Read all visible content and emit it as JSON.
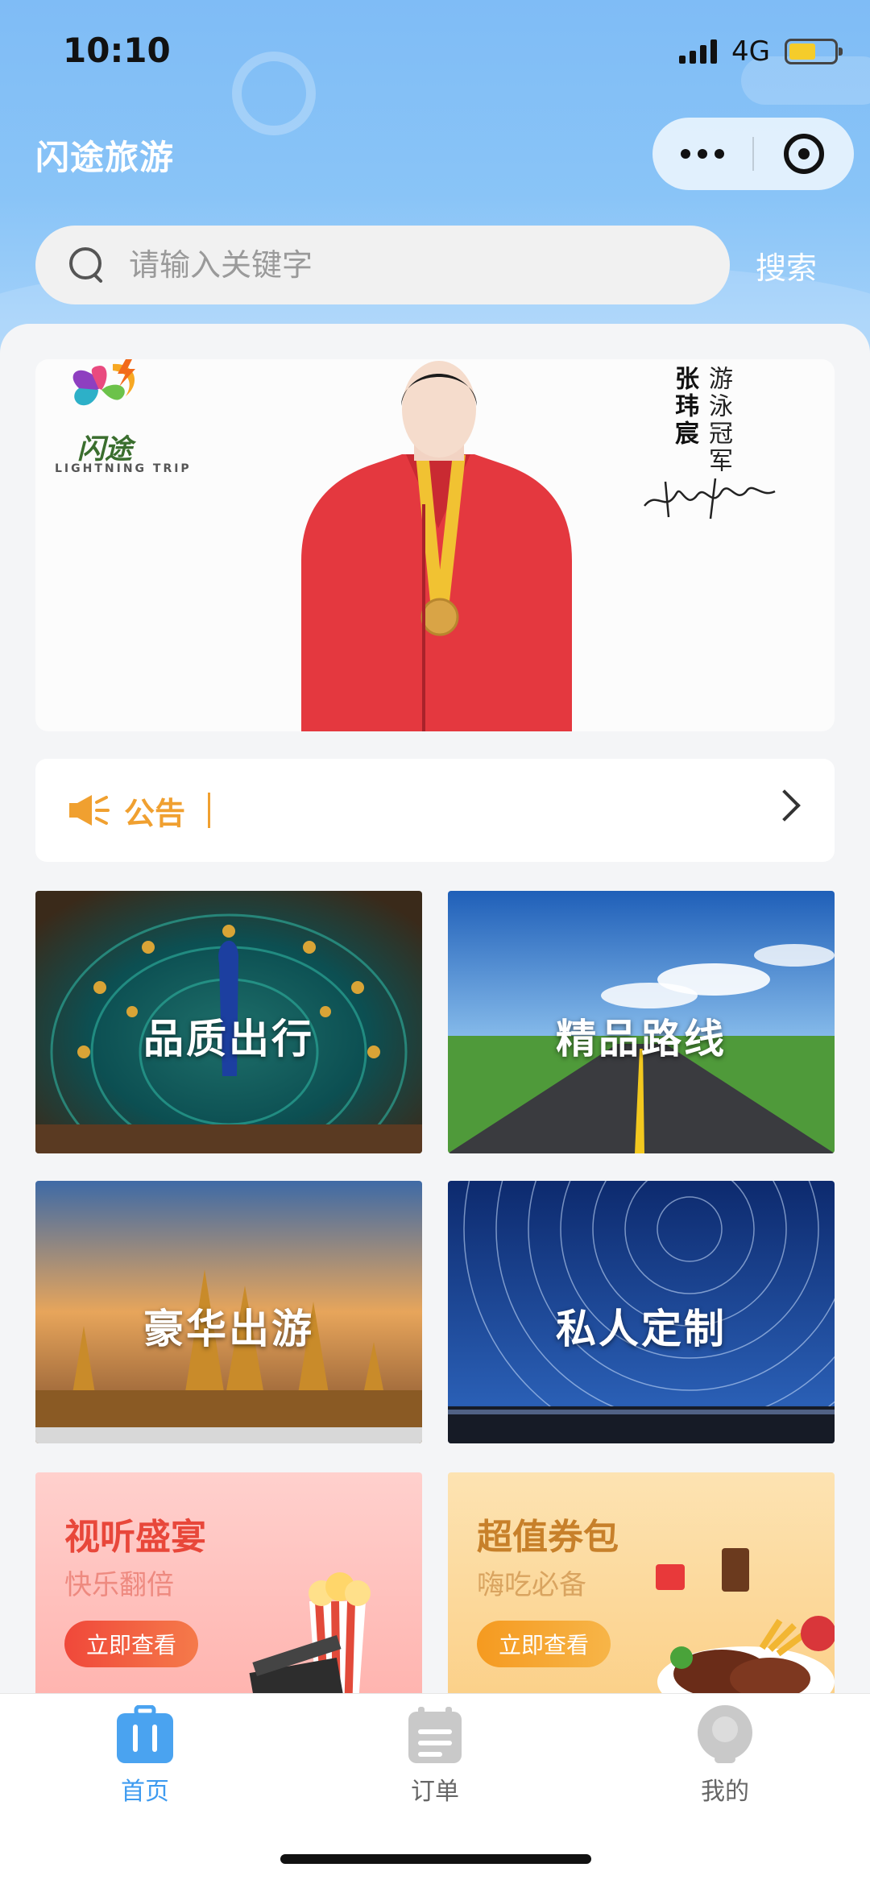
{
  "status_bar": {
    "time": "10:10",
    "network": "4G"
  },
  "header": {
    "app_title": "闪途旅游"
  },
  "search": {
    "placeholder": "请输入关键字",
    "value": "",
    "button_label": "搜索"
  },
  "banner": {
    "logo_text": "闪途",
    "logo_subtext": "LIGHTNING TRIP",
    "person_name": "张玮宸",
    "person_title": "游泳冠军"
  },
  "notice": {
    "label": "公告"
  },
  "tiles": [
    {
      "label": "品质出行"
    },
    {
      "label": "精品路线"
    },
    {
      "label": "豪华出游"
    },
    {
      "label": "私人定制"
    }
  ],
  "promos": [
    {
      "title": "视听盛宴",
      "subtitle": "快乐翻倍",
      "button": "立即查看"
    },
    {
      "title": "超值券包",
      "subtitle": "嗨吃必备",
      "button": "立即查看"
    }
  ],
  "tabbar": [
    {
      "label": "首页",
      "active": true
    },
    {
      "label": "订单",
      "active": false
    },
    {
      "label": "我的",
      "active": false
    }
  ],
  "colors": {
    "header_blue": "#7fbcf6",
    "accent_blue": "#3e9bf0",
    "notice_orange": "#f0a030",
    "promo_red": "#ef5a45",
    "promo_orange": "#f5a42a"
  }
}
